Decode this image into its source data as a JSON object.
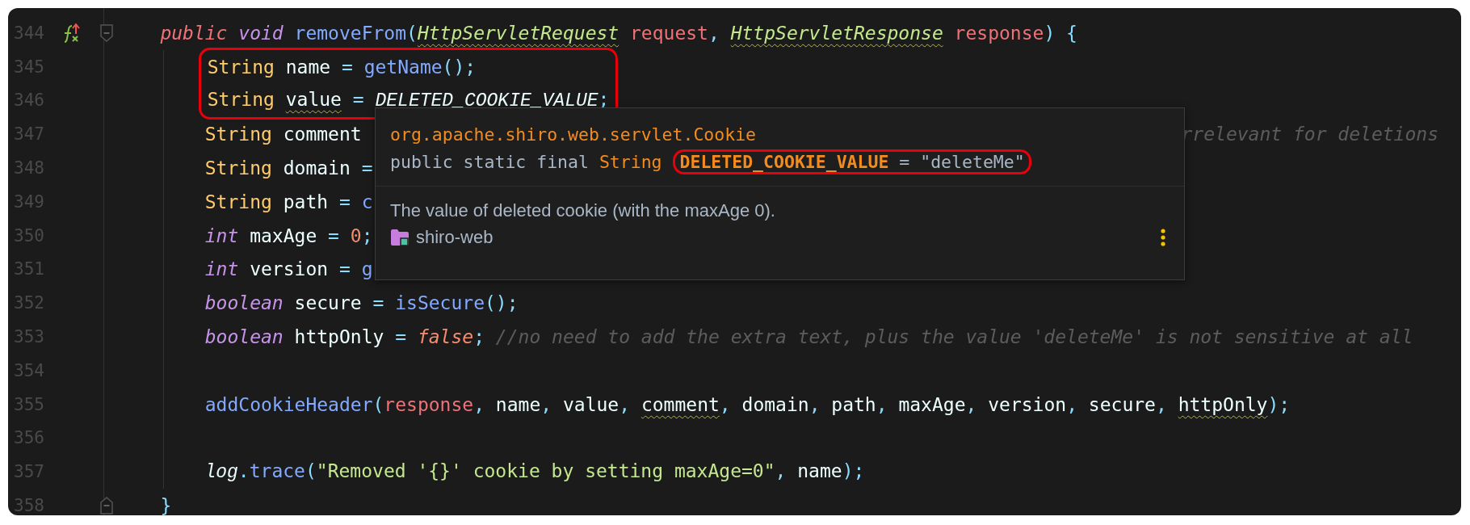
{
  "lines": [
    {
      "number": "344",
      "fold_start": true,
      "gutter_icon": true,
      "tokens": [
        {
          "kind": "mod",
          "text": "    public "
        },
        {
          "kind": "kw",
          "text": "void "
        },
        {
          "kind": "fn",
          "text": "removeFrom"
        },
        {
          "kind": "op",
          "text": "("
        },
        {
          "kind": "typei",
          "text": "HttpServletRequest",
          "warning": true
        },
        {
          "kind": "param",
          "text": " request"
        },
        {
          "kind": "op",
          "text": ", "
        },
        {
          "kind": "typei",
          "text": "HttpServletResponse",
          "warning": true
        },
        {
          "kind": "param",
          "text": " response"
        },
        {
          "kind": "op",
          "text": ") {"
        }
      ]
    },
    {
      "number": "345",
      "annotated": true,
      "tokens": [
        {
          "kind": "type",
          "text": "        String"
        },
        {
          "kind": "id",
          "text": " name "
        },
        {
          "kind": "op",
          "text": "= "
        },
        {
          "kind": "fn",
          "text": "getName"
        },
        {
          "kind": "op",
          "text": "();"
        }
      ]
    },
    {
      "number": "346",
      "annotated": true,
      "tokens": [
        {
          "kind": "type",
          "text": "        String "
        },
        {
          "kind": "id",
          "text": "value",
          "warning": true
        },
        {
          "kind": "op",
          "text": " = "
        },
        {
          "kind": "const",
          "text": "DELETED_COOKIE_VALUE"
        },
        {
          "kind": "op",
          "text": ";"
        }
      ]
    },
    {
      "number": "347",
      "tokens": [
        {
          "kind": "type",
          "text": "        String"
        },
        {
          "kind": "id",
          "text": " comment"
        }
      ],
      "tail": [
        {
          "kind": "cmt",
          "text": "rrelevant for deletions"
        }
      ]
    },
    {
      "number": "348",
      "tokens": [
        {
          "kind": "type",
          "text": "        String"
        },
        {
          "kind": "id",
          "text": " domain "
        },
        {
          "kind": "op",
          "text": "="
        }
      ]
    },
    {
      "number": "349",
      "tokens": [
        {
          "kind": "type",
          "text": "        String"
        },
        {
          "kind": "id",
          "text": " path "
        },
        {
          "kind": "op",
          "text": "= "
        },
        {
          "kind": "fn",
          "text": "c"
        }
      ]
    },
    {
      "number": "350",
      "tokens": [
        {
          "kind": "kw",
          "text": "        int"
        },
        {
          "kind": "id",
          "text": " maxAge "
        },
        {
          "kind": "op",
          "text": "= "
        },
        {
          "kind": "num",
          "text": "0"
        },
        {
          "kind": "op",
          "text": ";"
        }
      ]
    },
    {
      "number": "351",
      "tokens": [
        {
          "kind": "kw",
          "text": "        int"
        },
        {
          "kind": "id",
          "text": " version "
        },
        {
          "kind": "op",
          "text": "= "
        },
        {
          "kind": "fn",
          "text": "g"
        }
      ]
    },
    {
      "number": "352",
      "tokens": [
        {
          "kind": "kw",
          "text": "        boolean"
        },
        {
          "kind": "id",
          "text": " secure "
        },
        {
          "kind": "op",
          "text": "= "
        },
        {
          "kind": "fn",
          "text": "isSecure"
        },
        {
          "kind": "op",
          "text": "();"
        }
      ]
    },
    {
      "number": "353",
      "tokens": [
        {
          "kind": "kw",
          "text": "        boolean"
        },
        {
          "kind": "id",
          "text": " httpOnly "
        },
        {
          "kind": "op",
          "text": "= "
        },
        {
          "kind": "lit",
          "text": "false"
        },
        {
          "kind": "op",
          "text": "; "
        },
        {
          "kind": "cmt",
          "text": "//no need to add the extra text, plus the value 'deleteMe' is not sensitive at all"
        }
      ]
    },
    {
      "number": "354"
    },
    {
      "number": "355",
      "tokens": [
        {
          "kind": "fn",
          "text": "        addCookieHeader"
        },
        {
          "kind": "op",
          "text": "("
        },
        {
          "kind": "param",
          "text": "response"
        },
        {
          "kind": "op",
          "text": ", "
        },
        {
          "kind": "id",
          "text": "name"
        },
        {
          "kind": "op",
          "text": ", "
        },
        {
          "kind": "id",
          "text": "value"
        },
        {
          "kind": "op",
          "text": ", "
        },
        {
          "kind": "id",
          "text": "comment",
          "warning": true
        },
        {
          "kind": "op",
          "text": ", "
        },
        {
          "kind": "id",
          "text": "domain"
        },
        {
          "kind": "op",
          "text": ", "
        },
        {
          "kind": "id",
          "text": "path"
        },
        {
          "kind": "op",
          "text": ", "
        },
        {
          "kind": "id",
          "text": "maxAge"
        },
        {
          "kind": "op",
          "text": ", "
        },
        {
          "kind": "id",
          "text": "version"
        },
        {
          "kind": "op",
          "text": ", "
        },
        {
          "kind": "id",
          "text": "secure"
        },
        {
          "kind": "op",
          "text": ", "
        },
        {
          "kind": "id",
          "text": "httpOnly",
          "warning": true
        },
        {
          "kind": "op",
          "text": ");"
        }
      ]
    },
    {
      "number": "356"
    },
    {
      "number": "357",
      "tokens": [
        {
          "kind": "const",
          "text": "        log"
        },
        {
          "kind": "op",
          "text": "."
        },
        {
          "kind": "fn",
          "text": "trace"
        },
        {
          "kind": "op",
          "text": "("
        },
        {
          "kind": "str",
          "text": "\"Removed '{}' cookie by setting maxAge=0\""
        },
        {
          "kind": "op",
          "text": ", "
        },
        {
          "kind": "id",
          "text": "name"
        },
        {
          "kind": "op",
          "text": ");"
        }
      ]
    },
    {
      "number": "358",
      "fold_end": true,
      "tokens": [
        {
          "kind": "op",
          "text": "    }"
        }
      ]
    }
  ],
  "tooltip": {
    "qualified_name": "org.apache.shiro.web.servlet.Cookie",
    "signature": [
      {
        "kind": "plain",
        "text": "public static final "
      },
      {
        "kind": "type",
        "text": "String "
      },
      {
        "kind": "name",
        "text": "DELETED_COOKIE_VALUE",
        "annotated": true
      },
      {
        "kind": "plain",
        "text": " = \"deleteMe\"",
        "annotated": true
      }
    ],
    "description": "The value of deleted cookie (with the maxAge 0).",
    "module": "shiro-web"
  }
}
